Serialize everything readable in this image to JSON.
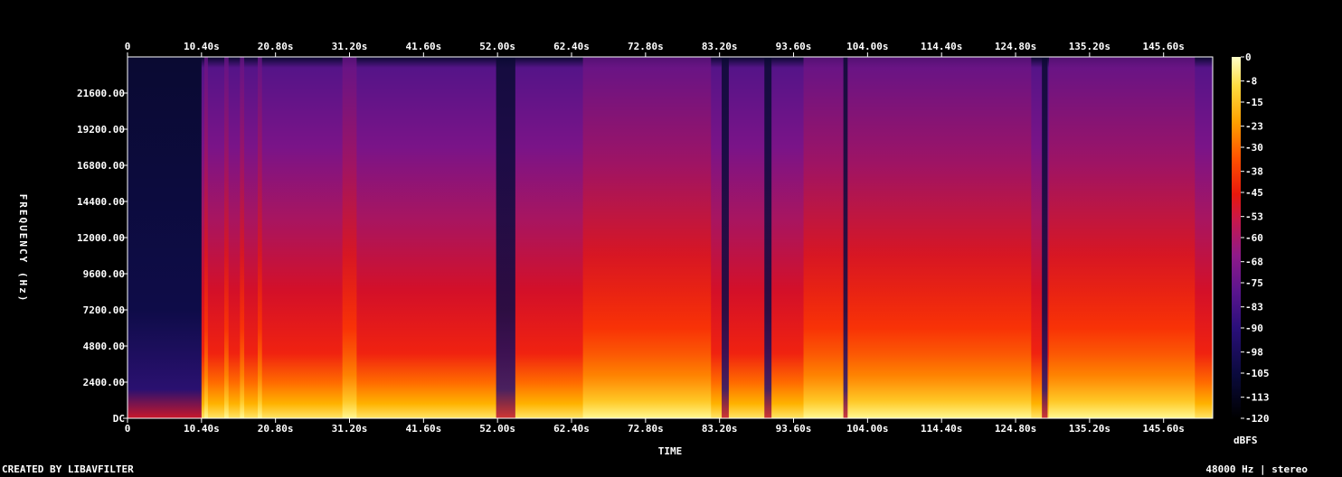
{
  "chart_data": {
    "type": "heatmap",
    "xlabel": "TIME",
    "ylabel": "FREQUENCY (Hz)",
    "x_ticks": [
      "0",
      "10.40s",
      "20.80s",
      "31.20s",
      "41.60s",
      "52.00s",
      "62.40s",
      "72.80s",
      "83.20s",
      "93.60s",
      "104.00s",
      "114.40s",
      "124.80s",
      "135.20s",
      "145.60s"
    ],
    "x_tick_values": [
      0,
      10.4,
      20.8,
      31.2,
      41.6,
      52.0,
      62.4,
      72.8,
      83.2,
      93.6,
      104.0,
      114.4,
      124.8,
      135.2,
      145.6
    ],
    "xlim": [
      0,
      152.5
    ],
    "y_ticks": [
      "DC",
      "2400.00",
      "4800.00",
      "7200.00",
      "9600.00",
      "12000.00",
      "14400.00",
      "16800.00",
      "19200.00",
      "21600.00"
    ],
    "y_tick_values": [
      0,
      2400,
      4800,
      7200,
      9600,
      12000,
      14400,
      16800,
      19200,
      21600
    ],
    "ylim": [
      0,
      24000
    ],
    "colorbar": {
      "label": "dBFS",
      "ticks": [
        "0",
        "-8",
        "-15",
        "-23",
        "-30",
        "-38",
        "-45",
        "-53",
        "-60",
        "-68",
        "-75",
        "-83",
        "-90",
        "-98",
        "-105",
        "-113",
        "-120"
      ],
      "tick_values": [
        0,
        -8,
        -15,
        -23,
        -30,
        -38,
        -45,
        -53,
        -60,
        -68,
        -75,
        -83,
        -90,
        -98,
        -105,
        -113,
        -120
      ],
      "range": [
        -120,
        0
      ]
    },
    "quiet_segments_s": [
      [
        0,
        10.4
      ],
      [
        51.8,
        54.5
      ],
      [
        83.5,
        84.5
      ],
      [
        89.5,
        90.5
      ],
      [
        100.6,
        101.2
      ],
      [
        128.5,
        129.3
      ]
    ],
    "loud_segments_s": [
      [
        10.8,
        11.3
      ],
      [
        13.6,
        14.2
      ],
      [
        15.8,
        16.4
      ],
      [
        18.3,
        18.9
      ],
      [
        30.2,
        32.2
      ],
      [
        64.0,
        82.0
      ],
      [
        95.0,
        127.0
      ],
      [
        129.5,
        150.0
      ]
    ]
  },
  "footer": {
    "left": "CREATED BY LIBAVFILTER",
    "right": "48000 Hz | stereo"
  },
  "colors": {
    "background": "#000000",
    "text": "#ffffff"
  }
}
